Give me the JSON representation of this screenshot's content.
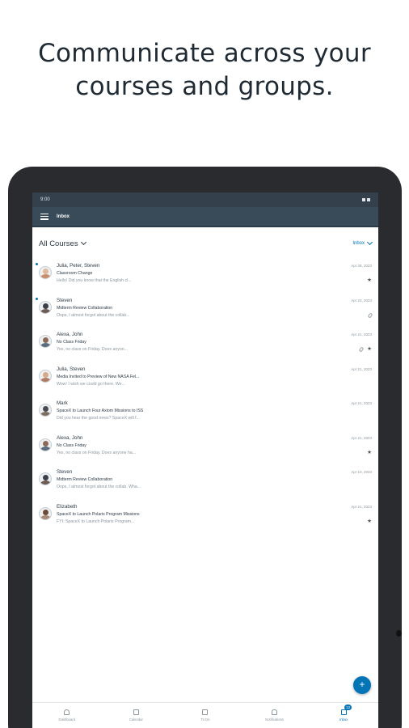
{
  "headline": {
    "line1": "Communicate across your",
    "line2": "courses and groups."
  },
  "statusbar": {
    "time": "9:00"
  },
  "appbar": {
    "title": "Inbox"
  },
  "filters": {
    "course": "All Courses",
    "scope": "Inbox"
  },
  "messages": [
    {
      "participants": "Julia, Peter, Steven",
      "date": "Apr 28, 2023",
      "subject": "Classroom Change",
      "preview": "Hello! Did you know that the English cl...",
      "unread": true,
      "attachment": false,
      "starred": true
    },
    {
      "participants": "Steven",
      "date": "Apr 23, 2023",
      "subject": "Midterm Review Collaboration",
      "preview": "Oops, I almost forgot about the collab...",
      "unread": true,
      "attachment": true,
      "starred": false
    },
    {
      "participants": "Alexa, John",
      "date": "Apr 21, 2023",
      "subject": "No Class Friday",
      "preview": "Yes, no class on Friday. Does anyon...",
      "unread": false,
      "attachment": true,
      "starred": true
    },
    {
      "participants": "Julia, Steven",
      "date": "Apr 21, 2023",
      "subject": "Media Invited to Preview of New NASA Fel...",
      "preview": "Wow! I wish we could go there. We...",
      "unread": false,
      "attachment": false,
      "starred": false
    },
    {
      "participants": "Mark",
      "date": "Apr 21, 2023",
      "subject": "SpaceX to Launch Four Axiom Missions to ISS",
      "preview": "Did you hear the good news? SpaceX will f...",
      "unread": false,
      "attachment": false,
      "starred": false
    },
    {
      "participants": "Alexa, John",
      "date": "Apr 21, 2023",
      "subject": "No Class Friday",
      "preview": "Yes, no class on Friday. Does anyone ha...",
      "unread": false,
      "attachment": false,
      "starred": true
    },
    {
      "participants": "Steven",
      "date": "Apr 10, 2023",
      "subject": "Midterm Review Collaboration",
      "preview": "Oops, I almost forgot about the collab. Wha...",
      "unread": false,
      "attachment": false,
      "starred": false
    },
    {
      "participants": "Elizabeth",
      "date": "Apr 21, 2023",
      "subject": "SpaceX to Launch Polaris Program Missions",
      "preview": "FYI: SpaceX to Launch Polaris Program...",
      "unread": false,
      "attachment": false,
      "starred": true
    }
  ],
  "tabs": [
    {
      "label": "Dashboard",
      "icon": "dashboard-icon"
    },
    {
      "label": "Calendar",
      "icon": "calendar-icon"
    },
    {
      "label": "To Do",
      "icon": "todo-icon"
    },
    {
      "label": "Notifications",
      "icon": "bell-icon"
    },
    {
      "label": "Inbox",
      "icon": "inbox-icon",
      "badge": "12",
      "active": true
    }
  ],
  "fab": {
    "label": "+"
  },
  "colors": {
    "accent": "#0374b5",
    "appbar": "#394b58",
    "statusbar": "#34414d",
    "device": "#2a2b2f"
  }
}
